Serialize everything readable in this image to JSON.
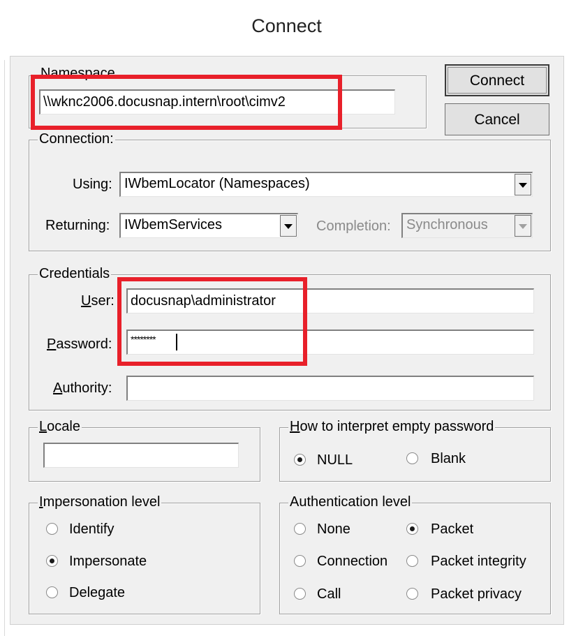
{
  "dialog": {
    "title": "Connect"
  },
  "buttons": {
    "connect": "Connect",
    "cancel": "Cancel"
  },
  "namespace": {
    "legend": "Namespace",
    "value": "\\\\wknc2006.docusnap.intern\\root\\cimv2"
  },
  "connection": {
    "legend": "Connection:",
    "using_label": "Using:",
    "using_value": "IWbemLocator (Namespaces)",
    "returning_label": "Returning:",
    "returning_value": "IWbemServices",
    "completion_label": "Completion:",
    "completion_value": "Synchronous"
  },
  "credentials": {
    "legend": "Credentials",
    "user_label": "User:",
    "user_value": "docusnap\\administrator",
    "password_label": "Password:",
    "password_value": "********",
    "authority_label": "Authority:",
    "authority_value": ""
  },
  "locale": {
    "legend": "Locale",
    "value": ""
  },
  "empty_password": {
    "legend": "How to interpret empty password",
    "options": [
      {
        "label": "NULL",
        "checked": true
      },
      {
        "label": "Blank",
        "checked": false
      }
    ]
  },
  "impersonation": {
    "legend": "Impersonation level",
    "options": [
      {
        "label": "Identify",
        "checked": false
      },
      {
        "label": "Impersonate",
        "checked": true
      },
      {
        "label": "Delegate",
        "checked": false
      }
    ]
  },
  "authentication": {
    "legend": "Authentication level",
    "options": [
      {
        "label": "None",
        "checked": false
      },
      {
        "label": "Packet",
        "checked": true
      },
      {
        "label": "Connection",
        "checked": false
      },
      {
        "label": "Packet integrity",
        "checked": false
      },
      {
        "label": "Call",
        "checked": false
      },
      {
        "label": "Packet privacy",
        "checked": false
      }
    ]
  },
  "annotation_color": "#e8202a"
}
